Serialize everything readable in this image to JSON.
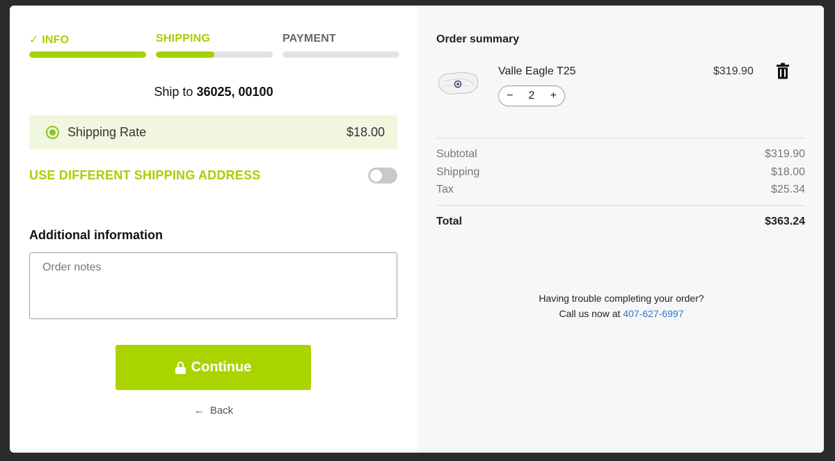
{
  "steps": [
    {
      "label": "✓ INFO",
      "progress": 1.0
    },
    {
      "label": "SHIPPING",
      "progress": 0.5
    },
    {
      "label": "PAYMENT",
      "progress": 0.0
    }
  ],
  "ship_to": {
    "prefix": "Ship to",
    "address": "36025, 00100"
  },
  "shipping_rate": {
    "name": "Shipping Rate",
    "price": "$18.00",
    "selected": true
  },
  "different_address": {
    "label": "USE DIFFERENT SHIPPING ADDRESS",
    "enabled": false
  },
  "additional_info": {
    "title": "Additional information",
    "notes_placeholder": "Order notes",
    "notes_value": ""
  },
  "continue_label": "Continue",
  "back_label": "Back",
  "summary": {
    "title": "Order summary",
    "item": {
      "name": "Valle Eagle T25",
      "quantity": "2",
      "minus": "−",
      "plus": "+",
      "price": "$319.90"
    },
    "subtotal": {
      "label": "Subtotal",
      "value": "$319.90"
    },
    "shipping": {
      "label": "Shipping",
      "value": "$18.00"
    },
    "tax": {
      "label": "Tax",
      "value": "$25.34"
    },
    "total": {
      "label": "Total",
      "value": "$363.24"
    }
  },
  "help": {
    "line1": "Having trouble completing your order?",
    "line2_prefix": "Call us now at",
    "phone": "407-627-6997"
  },
  "colors": {
    "accent": "#aad400",
    "link": "#2a7ac8",
    "rate_bg": "#f1f7df",
    "panel_bg": "#f7f7f9"
  }
}
